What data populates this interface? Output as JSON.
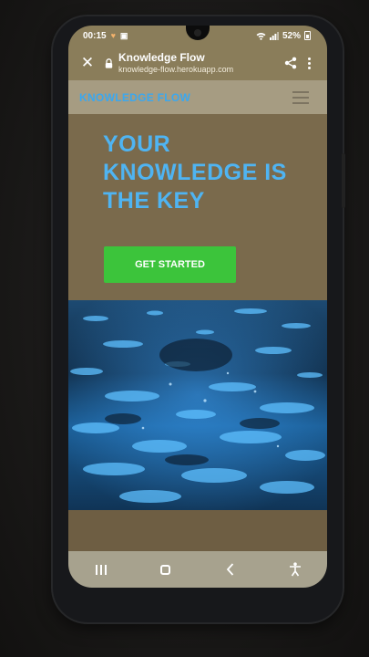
{
  "status_bar": {
    "time": "00:15",
    "battery": "52%"
  },
  "tab_bar": {
    "title": "Knowledge Flow",
    "url": "knowledge-flow.herokuapp.com"
  },
  "site": {
    "logo": "KNOWLEDGE FLOW",
    "headline": "YOUR KNOWLEDGE IS THE KEY",
    "cta_label": "GET STARTED"
  },
  "icons": {
    "close": "close-icon",
    "lock": "lock-icon",
    "share": "share-icon",
    "more": "more-vertical-icon",
    "menu": "hamburger-menu-icon",
    "recents": "recents-icon",
    "home": "home-icon",
    "back": "back-icon",
    "accessibility": "accessibility-icon"
  },
  "colors": {
    "header_bar": "#8a7d5a",
    "logo": "#3aa8f0",
    "headline": "#4fb4f2",
    "cta": "#3cc43b",
    "nav_bar": "#a7a28e"
  }
}
